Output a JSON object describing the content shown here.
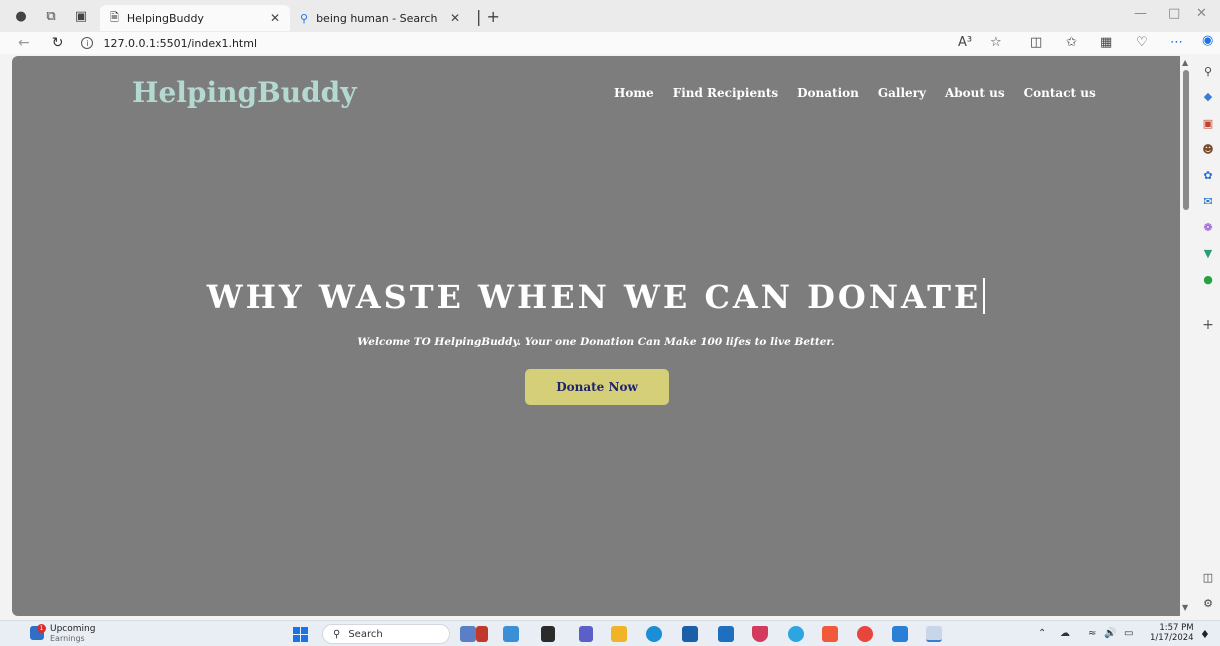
{
  "browser": {
    "tabs": [
      {
        "title": "HelpingBuddy",
        "icon": "page-icon",
        "active": true
      },
      {
        "title": "being human - Search",
        "icon": "search-icon",
        "active": false
      }
    ],
    "url": "127.0.0.1:5501/index1.html",
    "read_aloud": "A³"
  },
  "page": {
    "brand": "HelpingBuddy",
    "nav": [
      "Home",
      "Find Recipients",
      "Donation",
      "Gallery",
      "About us",
      "Contact us"
    ],
    "hero_title": "WHY WASTE WHEN WE CAN DONATE",
    "hero_subtitle": "Welcome TO HelpingBuddy. Your one Donation Can Make 100 lifes to live Better.",
    "cta": "Donate Now",
    "colors": {
      "background": "#7d7d7d",
      "brand": "#b3d9d0",
      "button": "#d6cf7a",
      "button_text": "#1d2370"
    }
  },
  "taskbar": {
    "weather_title": "Upcoming",
    "weather_sub": "Earnings",
    "weather_badge": "1",
    "search_placeholder": "Search",
    "time": "1:57 PM",
    "date": "1/17/2024"
  }
}
